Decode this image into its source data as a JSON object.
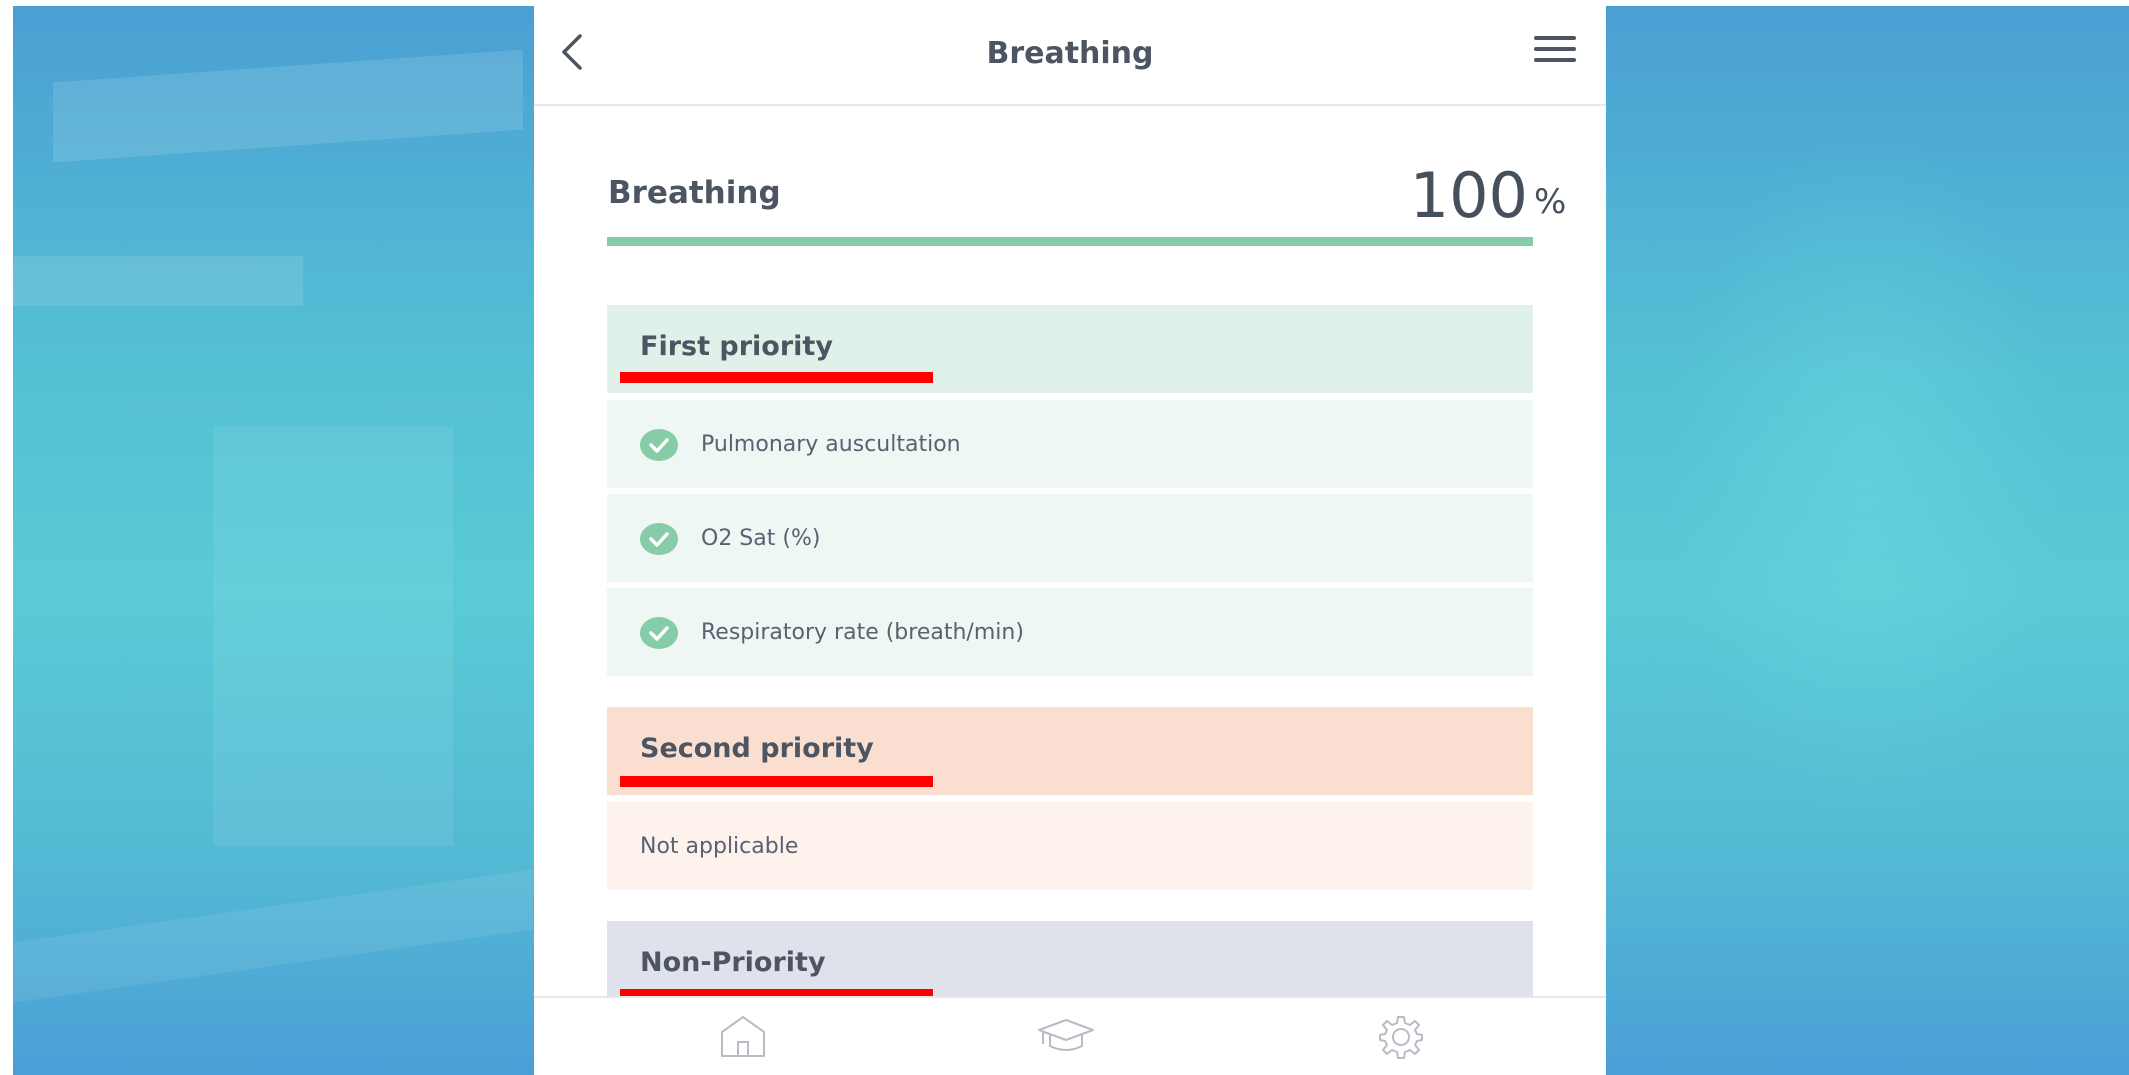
{
  "header": {
    "title": "Breathing",
    "back_icon": "chevron-left-icon",
    "menu_icon": "hamburger-menu-icon"
  },
  "summary": {
    "label": "Breathing",
    "value": "100",
    "unit": "%",
    "progress_percent": 100,
    "progress_color": "#86cca7"
  },
  "sections": {
    "first": {
      "title": "First priority",
      "color": "#dff1e8",
      "items": [
        {
          "label": "Pulmonary auscultation",
          "checked": true
        },
        {
          "label": "O2 Sat (%)",
          "checked": true
        },
        {
          "label": "Respiratory rate (breath/min)",
          "checked": true
        }
      ]
    },
    "second": {
      "title": "Second priority",
      "color": "#fadfd0",
      "empty_text": "Not applicable"
    },
    "non_priority": {
      "title": "Non-Priority",
      "color": "#dfe1eb"
    }
  },
  "annotation_color": "#ff0000",
  "check_color": "#86cca7",
  "bottom_nav": {
    "items": [
      {
        "icon": "home-icon"
      },
      {
        "icon": "graduation-cap-icon"
      },
      {
        "icon": "settings-gear-icon"
      }
    ]
  }
}
